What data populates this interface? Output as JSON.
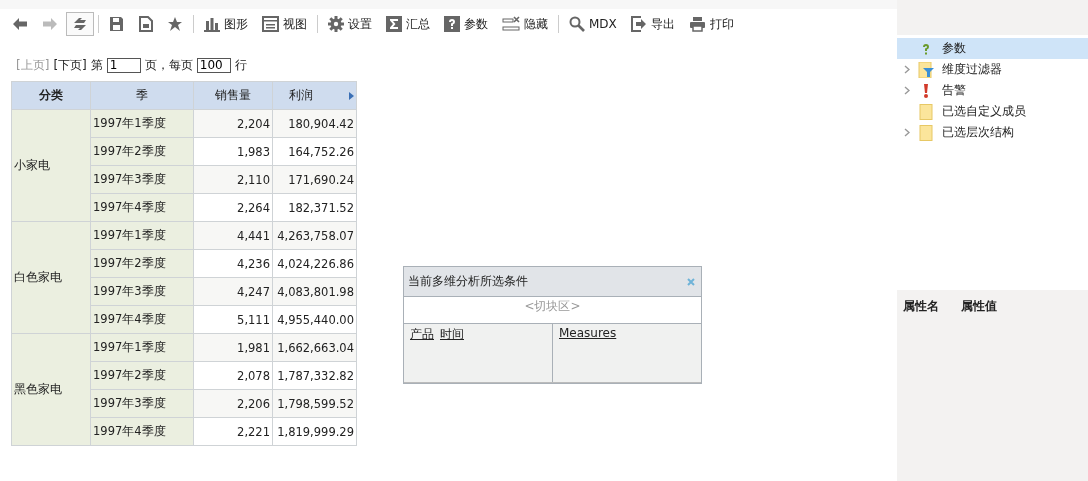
{
  "toolbar": [
    {
      "kind": "back",
      "disabled": false,
      "selected": false
    },
    {
      "kind": "forward",
      "disabled": true,
      "selected": false
    },
    {
      "kind": "refresh",
      "disabled": false,
      "selected": true
    },
    {
      "kind": "separator"
    },
    {
      "kind": "save",
      "disabled": false,
      "selected": false
    },
    {
      "kind": "save-as",
      "disabled": false,
      "selected": false
    },
    {
      "kind": "star",
      "disabled": false,
      "selected": false
    },
    {
      "kind": "separator"
    },
    {
      "kind": "chart",
      "label": "图形",
      "disabled": false,
      "selected": false
    },
    {
      "kind": "view",
      "label": "视图",
      "disabled": false,
      "selected": false
    },
    {
      "kind": "separator"
    },
    {
      "kind": "gear",
      "label": "设置",
      "disabled": false,
      "selected": false
    },
    {
      "kind": "sum",
      "label": "汇总",
      "disabled": false,
      "selected": false
    },
    {
      "kind": "help",
      "label": "参数",
      "disabled": false,
      "selected": false
    },
    {
      "kind": "hide",
      "label": "隐藏",
      "disabled": false,
      "selected": false
    },
    {
      "kind": "separator"
    },
    {
      "kind": "search",
      "label": "MDX",
      "disabled": false,
      "selected": false
    },
    {
      "kind": "export",
      "label": "导出",
      "disabled": false,
      "selected": false
    },
    {
      "kind": "print",
      "label": "打印",
      "disabled": false,
      "selected": false
    }
  ],
  "pager": {
    "prev": {
      "label": "[上页]",
      "disabled": true
    },
    "next": {
      "label": "[下页]",
      "disabled": false
    },
    "page_prefix": "第",
    "page": "1",
    "page_suffix": "页，每页",
    "page_size": "100",
    "rows_suffix": "行"
  },
  "table": {
    "columns": [
      "分类",
      "季",
      "销售量",
      "利润"
    ],
    "groups": [
      {
        "category": "小家电",
        "rows": [
          [
            "1997年1季度",
            "2,204",
            "180,904.42"
          ],
          [
            "1997年2季度",
            "1,983",
            "164,752.26"
          ],
          [
            "1997年3季度",
            "2,110",
            "171,690.24"
          ],
          [
            "1997年4季度",
            "2,264",
            "182,371.52"
          ]
        ]
      },
      {
        "category": "白色家电",
        "rows": [
          [
            "1997年1季度",
            "4,441",
            "4,263,758.07"
          ],
          [
            "1997年2季度",
            "4,236",
            "4,024,226.86"
          ],
          [
            "1997年3季度",
            "4,247",
            "4,083,801.98"
          ],
          [
            "1997年4季度",
            "5,111",
            "4,955,440.00"
          ]
        ]
      },
      {
        "category": "黑色家电",
        "rows": [
          [
            "1997年1季度",
            "1,981",
            "1,662,663.04"
          ],
          [
            "1997年2季度",
            "2,078",
            "1,787,332.82"
          ],
          [
            "1997年3季度",
            "2,206",
            "1,798,599.52"
          ],
          [
            "1997年4季度",
            "2,221",
            "1,819,999.29"
          ]
        ]
      }
    ]
  },
  "dialog": {
    "title": "当前多维分析所选条件",
    "slicer": "<切块区>",
    "rows_fields": [
      "产品",
      "时间"
    ],
    "column_fields": [
      "Measures"
    ]
  },
  "tree": [
    {
      "kind": "help",
      "label": "参数",
      "expandable": false,
      "selected": true
    },
    {
      "kind": "filter",
      "label": "维度过滤器",
      "expandable": true,
      "selected": false
    },
    {
      "kind": "alert",
      "label": "告警",
      "expandable": true,
      "selected": false
    },
    {
      "kind": "folder",
      "label": "已选自定义成员",
      "expandable": false,
      "selected": false
    },
    {
      "kind": "folder",
      "label": "已选层次结构",
      "expandable": true,
      "selected": false
    }
  ],
  "properties": {
    "columns": [
      "属性名",
      "属性值"
    ]
  }
}
